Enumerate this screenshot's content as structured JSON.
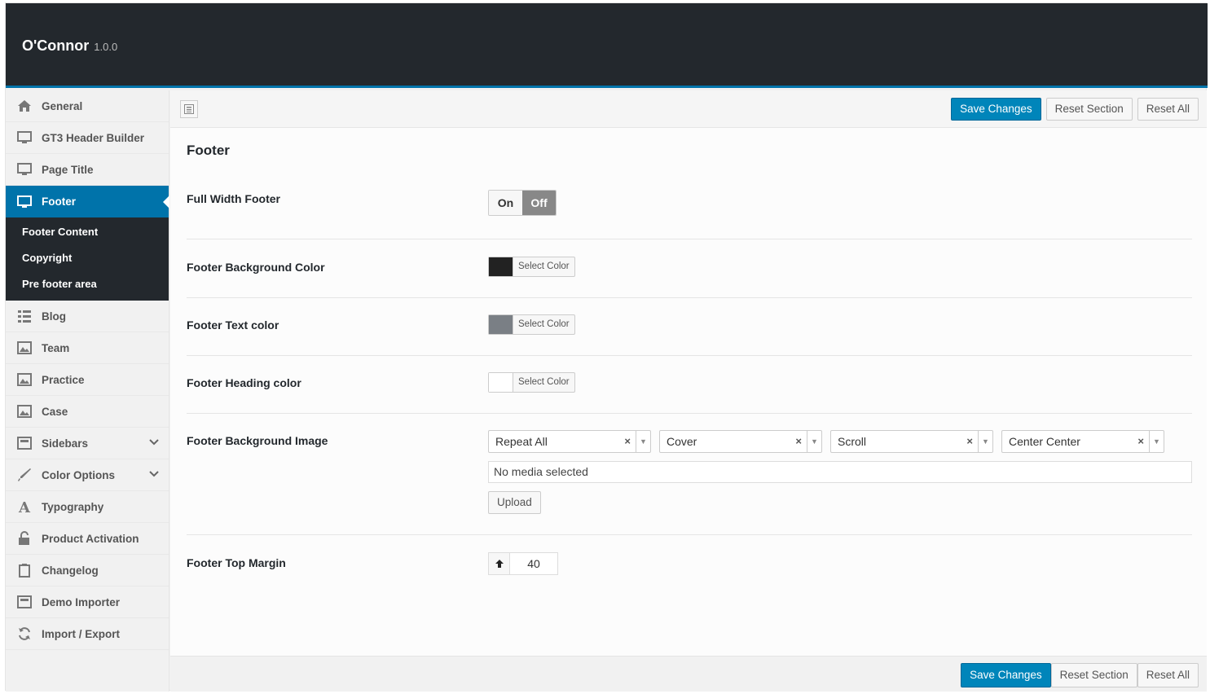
{
  "app": {
    "name": "O'Connor",
    "version": "1.0.0"
  },
  "sidebar": {
    "items": [
      {
        "label": "General",
        "icon": "home-icon"
      },
      {
        "label": "GT3 Header Builder",
        "icon": "monitor-icon"
      },
      {
        "label": "Page Title",
        "icon": "monitor-icon"
      },
      {
        "label": "Footer",
        "icon": "monitor-icon",
        "active": true
      },
      {
        "label": "Blog",
        "icon": "list-icon"
      },
      {
        "label": "Team",
        "icon": "image-icon"
      },
      {
        "label": "Practice",
        "icon": "image-icon"
      },
      {
        "label": "Case",
        "icon": "image-icon"
      },
      {
        "label": "Sidebars",
        "icon": "layout-icon"
      },
      {
        "label": "Color Options",
        "icon": "brush-icon"
      },
      {
        "label": "Typography",
        "icon": "typography-icon"
      },
      {
        "label": "Product Activation",
        "icon": "unlock-icon"
      },
      {
        "label": "Changelog",
        "icon": "clipboard-icon"
      },
      {
        "label": "Demo Importer",
        "icon": "layout-icon"
      },
      {
        "label": "Import / Export",
        "icon": "refresh-icon"
      }
    ],
    "subitems": [
      "Footer Content",
      "Copyright",
      "Pre footer area"
    ]
  },
  "toolbar": {
    "save": "Save Changes",
    "reset_section": "Reset Section",
    "reset_all": "Reset All"
  },
  "section": {
    "title": "Footer",
    "full_width": {
      "label": "Full Width Footer",
      "on": "On",
      "off": "Off",
      "value": "Off"
    },
    "bg_color": {
      "label": "Footer Background Color",
      "button": "Select Color",
      "color": "#222222"
    },
    "text_color": {
      "label": "Footer Text color",
      "button": "Select Color",
      "color": "#7a7f85"
    },
    "heading_color": {
      "label": "Footer Heading color",
      "button": "Select Color",
      "color": "#ffffff"
    },
    "bg_image": {
      "label": "Footer Background Image",
      "repeat": "Repeat All",
      "size": "Cover",
      "attachment": "Scroll",
      "position": "Center Center",
      "media": "No media selected",
      "upload": "Upload"
    },
    "top_margin": {
      "label": "Footer Top Margin",
      "value": "40"
    }
  },
  "colors": {
    "accent": "#0073aa",
    "header_bg": "#23282d"
  }
}
